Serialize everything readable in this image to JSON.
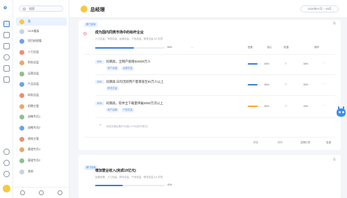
{
  "sidebar": {
    "search_placeholder": "搜索",
    "items": [
      {
        "label": "我"
      },
      {
        "label": "OKR看板"
      },
      {
        "label": "项目经理看"
      },
      {
        "label": "人力总监"
      },
      {
        "label": "财务总监"
      },
      {
        "label": "运营总监"
      },
      {
        "label": "产品总监"
      },
      {
        "label": "研发总监"
      },
      {
        "label": "招聘主管"
      },
      {
        "label": "战略专员1"
      },
      {
        "label": "战略专员2"
      },
      {
        "label": "绩效主管"
      },
      {
        "label": "渠道专员1"
      },
      {
        "label": "渠道专员2"
      },
      {
        "label": "其他"
      }
    ]
  },
  "header": {
    "title": "总经理",
    "date_range": "2020年07月 ~ 09月"
  },
  "objective1": {
    "tag": "部门目标",
    "title": "成为国内同类市场中的标杆企业",
    "meta": "人力总监、市场总监、运营总监、产品总监、研发总监 5人共同",
    "progress_label": "56%",
    "progress": 56,
    "col_status": "进度",
    "col_conf": "信心",
    "col_weight": "权重",
    "col_more": "操作"
  },
  "krs": [
    {
      "badge": "KR1",
      "title": "同期高，全网产值增长5000万人",
      "chips": [
        "用户运营",
        "运营总监"
      ],
      "pct": "80%",
      "conf": "7",
      "weight": "30%",
      "progress": 80,
      "color": "blue"
    },
    {
      "badge": "KR2",
      "title": "同期高,日均活跃用户量增涨至50万人以上",
      "chips": [
        "研发总监"
      ],
      "pct": "80%",
      "conf": "7",
      "weight": "30%",
      "progress": 80,
      "color": "blue"
    },
    {
      "badge": "KR3",
      "title": "同期高，软件全下载量突破3000万次以上",
      "chips": [
        "用户运营",
        "产品总监"
      ],
      "pct": "80%",
      "conf": "7",
      "weight": "40%",
      "progress": 80,
      "color": "orange"
    }
  ],
  "add_kr_label": "添加关键结果(KR)(输入KR后回车提交)",
  "footer": {
    "a": "评论",
    "b": "评分",
    "c": "进展记录",
    "d": "复盘"
  },
  "objective2": {
    "tag": "部门目标",
    "title": "增加营业收入(完成10亿元)",
    "meta": "运营经理、人力总监、财务总监、产品总监、研发总监 6人共同",
    "progress_label": "40%",
    "progress": 40
  }
}
